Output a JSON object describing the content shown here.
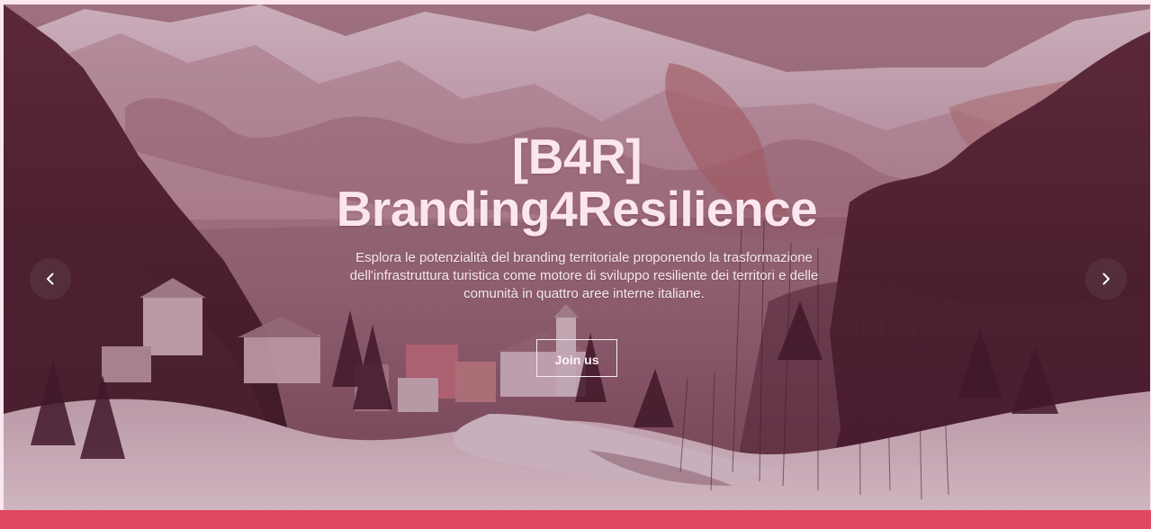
{
  "hero": {
    "title_line_1": "[B4R]",
    "title_line_2": "Branding4Resilience",
    "description": "Esplora le potenzialità del branding territoriale proponendo la trasformazione dell'infrastruttura turistica come motore di sviluppo resiliente dei territori e delle comunità in quattro aree interne italiane.",
    "cta_label": "Join us"
  },
  "controls": {
    "previous_icon": "chevron-left-icon",
    "next_icon": "chevron-right-icon"
  },
  "colors": {
    "page_background": "#fbe7ef",
    "accent_band": "#e0475f",
    "overlay": "#581c32",
    "text": "#fbe5ef"
  }
}
